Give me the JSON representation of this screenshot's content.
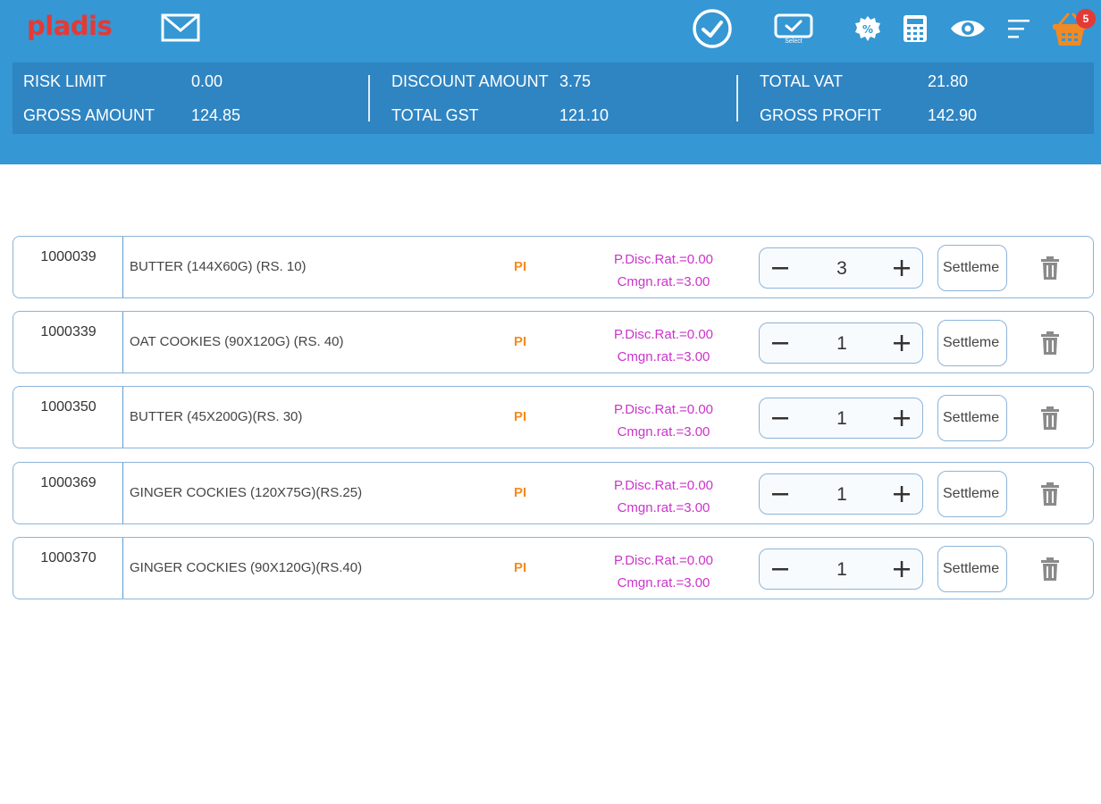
{
  "app": {
    "logo_text": "pladis"
  },
  "toolbar": {
    "icons": [
      "check-circle-icon",
      "select-card-icon",
      "percent-icon",
      "calculator-icon",
      "eye-icon",
      "menu-icon",
      "basket-icon"
    ],
    "select_label": "Select",
    "cart_count": "5"
  },
  "summary": {
    "risk_limit_label": "RISK LIMIT",
    "risk_limit_value": "0.00",
    "gross_amount_label": "GROSS AMOUNT",
    "gross_amount_value": "124.85",
    "discount_amount_label": "DISCOUNT AMOUNT",
    "discount_amount_value": "3.75",
    "total_gst_label": "TOTAL GST",
    "total_gst_value": "121.10",
    "total_vat_label": "TOTAL VAT",
    "total_vat_value": "21.80",
    "gross_profit_label": "GROSS PROFIT",
    "gross_profit_value": "142.90"
  },
  "items": [
    {
      "code": "1000039",
      "name": "BUTTER (144X60G) (RS. 10)",
      "tag": "PI",
      "disc_rate": "P.Disc.Rat.=0.00",
      "cmgn_rate": "Cmgn.rat.=3.00",
      "qty": "3",
      "settle_label": "Settleme"
    },
    {
      "code": "1000339",
      "name": "OAT COOKIES (90X120G) (RS. 40)",
      "tag": "PI",
      "disc_rate": "P.Disc.Rat.=0.00",
      "cmgn_rate": "Cmgn.rat.=3.00",
      "qty": "1",
      "settle_label": "Settleme"
    },
    {
      "code": "1000350",
      "name": "BUTTER (45X200G)(RS. 30)",
      "tag": "PI",
      "disc_rate": "P.Disc.Rat.=0.00",
      "cmgn_rate": "Cmgn.rat.=3.00",
      "qty": "1",
      "settle_label": "Settleme"
    },
    {
      "code": "1000369",
      "name": "GINGER COCKIES (120X75G)(RS.25)",
      "tag": "PI",
      "disc_rate": "P.Disc.Rat.=0.00",
      "cmgn_rate": "Cmgn.rat.=3.00",
      "qty": "1",
      "settle_label": "Settleme"
    },
    {
      "code": "1000370",
      "name": "GINGER COCKIES (90X120G)(RS.40)",
      "tag": "PI",
      "disc_rate": "P.Disc.Rat.=0.00",
      "cmgn_rate": "Cmgn.rat.=3.00",
      "qty": "1",
      "settle_label": "Settleme"
    }
  ],
  "colors": {
    "header": "#3597d3",
    "summary": "#2f84c2",
    "logo": "#e53935",
    "pi_tag": "#f28c1e",
    "rate_text": "#cc33cc",
    "badge": "#e53935",
    "basket": "#f08a24"
  }
}
